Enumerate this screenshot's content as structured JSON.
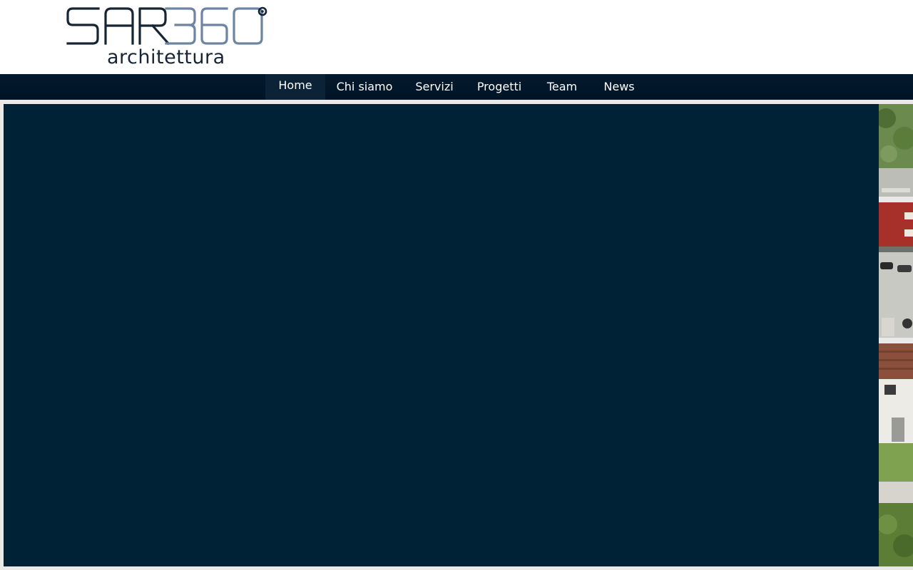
{
  "brand": {
    "logo_text": "SAR360°",
    "tagline": "architettura",
    "colors": {
      "dark": "#162535",
      "accent": "#6d84a3"
    }
  },
  "nav": {
    "items": [
      {
        "label": "Home",
        "active": true
      },
      {
        "label": "Chi siamo"
      },
      {
        "label": "Servizi"
      },
      {
        "label": "Progetti"
      },
      {
        "label": "Team"
      },
      {
        "label": "News"
      }
    ],
    "colors": {
      "bar": "#001428",
      "active_bg": "#0b2237",
      "text": "#ffffff"
    }
  },
  "hero": {
    "background": "#002236",
    "side_image": "aerial-photo-of-buildings"
  }
}
